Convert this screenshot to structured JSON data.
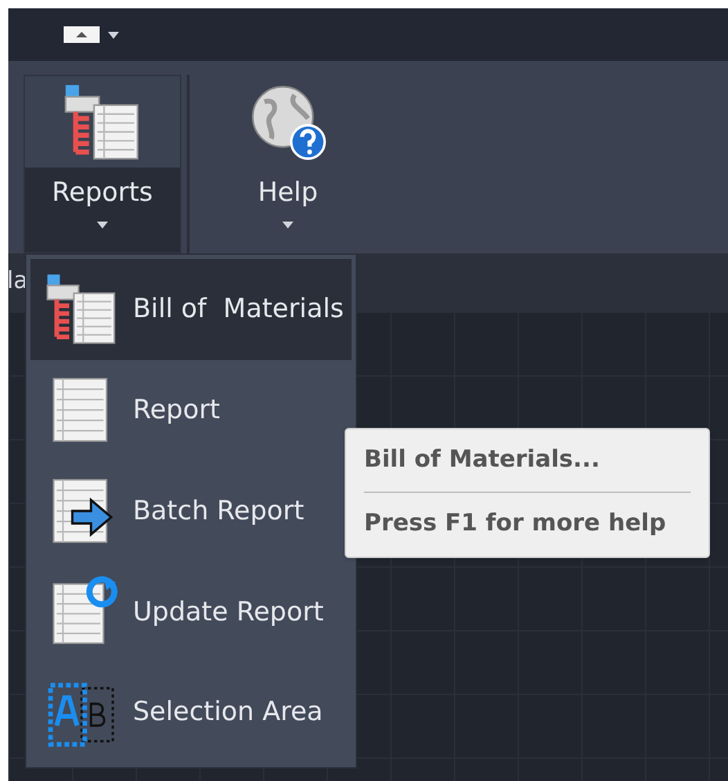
{
  "ribbon": {
    "buttons": [
      {
        "label": "Reports",
        "kind": "bom",
        "selected": true
      },
      {
        "label": "Help",
        "kind": "help",
        "selected": false
      }
    ]
  },
  "side_text": "la",
  "menu": {
    "items": [
      {
        "label": "Bill of  Materials",
        "kind": "bom",
        "selected": true
      },
      {
        "label": "Report",
        "kind": "report",
        "selected": false
      },
      {
        "label": "Batch Report",
        "kind": "batch",
        "selected": false
      },
      {
        "label": "Update Report",
        "kind": "update",
        "selected": false
      },
      {
        "label": "Selection Area",
        "kind": "selection",
        "selected": false
      }
    ]
  },
  "tooltip": {
    "title": "Bill of Materials...",
    "hint": "Press F1 for more help"
  }
}
